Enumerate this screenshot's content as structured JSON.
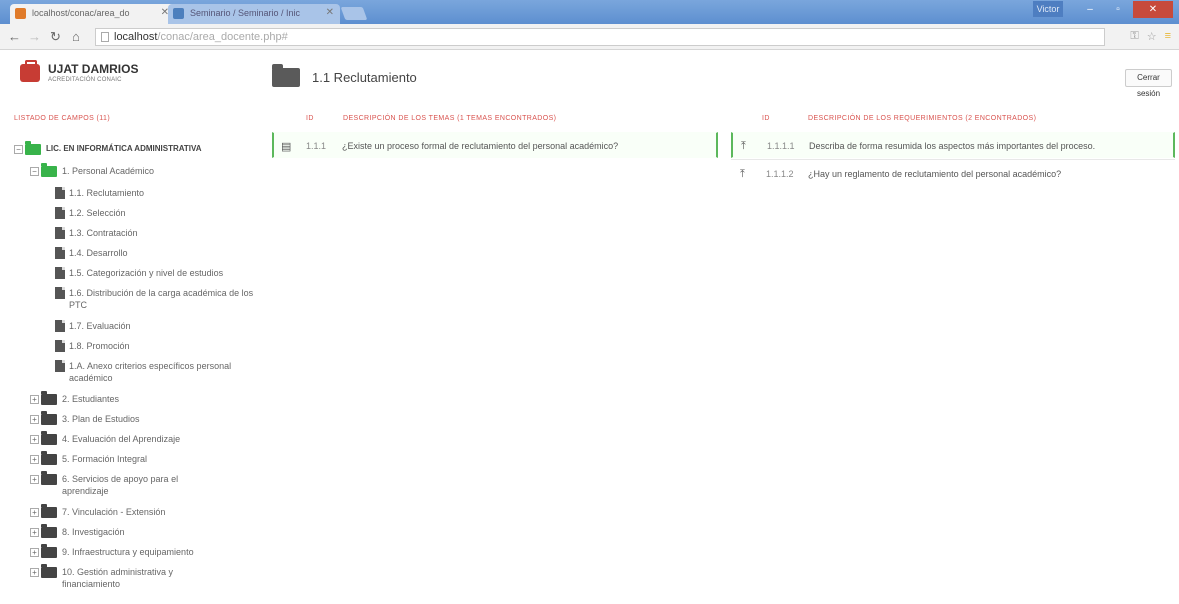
{
  "browser": {
    "tabs": [
      {
        "label": "localhost/conac/area_do"
      },
      {
        "label": "Seminario / Seminario / Inic"
      }
    ],
    "user_label": "Victor",
    "url_host": "localhost",
    "url_path": "/conac/area_docente.php#"
  },
  "app": {
    "logo_title": "UJAT DAMRIOS",
    "logo_subtitle": "ACREDITACIÓN CONAIC",
    "page_title": "1.1  Reclutamiento",
    "logout_label": "Cerrar sesión"
  },
  "sidebar": {
    "header": "LISTADO DE CAMPOS (11)",
    "root_label": "LIC. EN INFORMÁTICA ADMINISTRATIVA",
    "category_1_label": "1. Personal Académico",
    "subitems": [
      {
        "label": "1.1. Reclutamiento"
      },
      {
        "label": "1.2. Selección"
      },
      {
        "label": "1.3. Contratación"
      },
      {
        "label": "1.4. Desarrollo"
      },
      {
        "label": "1.5. Categorización y nivel de estudios"
      },
      {
        "label": "1.6. Distribución de la carga académica de los PTC"
      },
      {
        "label": "1.7. Evaluación"
      },
      {
        "label": "1.8. Promoción"
      },
      {
        "label": "1.A. Anexo criterios específicos personal académico"
      }
    ],
    "categories": [
      {
        "label": "2. Estudiantes"
      },
      {
        "label": "3. Plan de Estudios"
      },
      {
        "label": "4. Evaluación del Aprendizaje"
      },
      {
        "label": "5. Formación Integral"
      },
      {
        "label": "6. Servicios de apoyo para el aprendizaje"
      },
      {
        "label": "7. Vinculación - Extensión"
      },
      {
        "label": "8. Investigación"
      },
      {
        "label": "9. Infraestructura y equipamiento"
      },
      {
        "label": "10. Gestión administrativa y financiamiento"
      }
    ]
  },
  "topics": {
    "col_id": "ID",
    "col_desc": "DESCRIPCIÓN DE LOS TEMAS (1 TEMAS ENCONTRADOS)",
    "rows": [
      {
        "id": "1.1.1",
        "text": "¿Existe un proceso formal de reclutamiento del personal académico?"
      }
    ]
  },
  "requirements": {
    "col_id": "ID",
    "col_desc": "DESCRIPCIÓN DE LOS REQUERIMIENTOS (2 ENCONTRADOS)",
    "rows": [
      {
        "id": "1.1.1.1",
        "text": "Describa de forma resumida los aspectos más importantes del proceso."
      },
      {
        "id": "1.1.1.2",
        "text": "¿Hay un reglamento de reclutamiento del personal académico?"
      }
    ]
  }
}
